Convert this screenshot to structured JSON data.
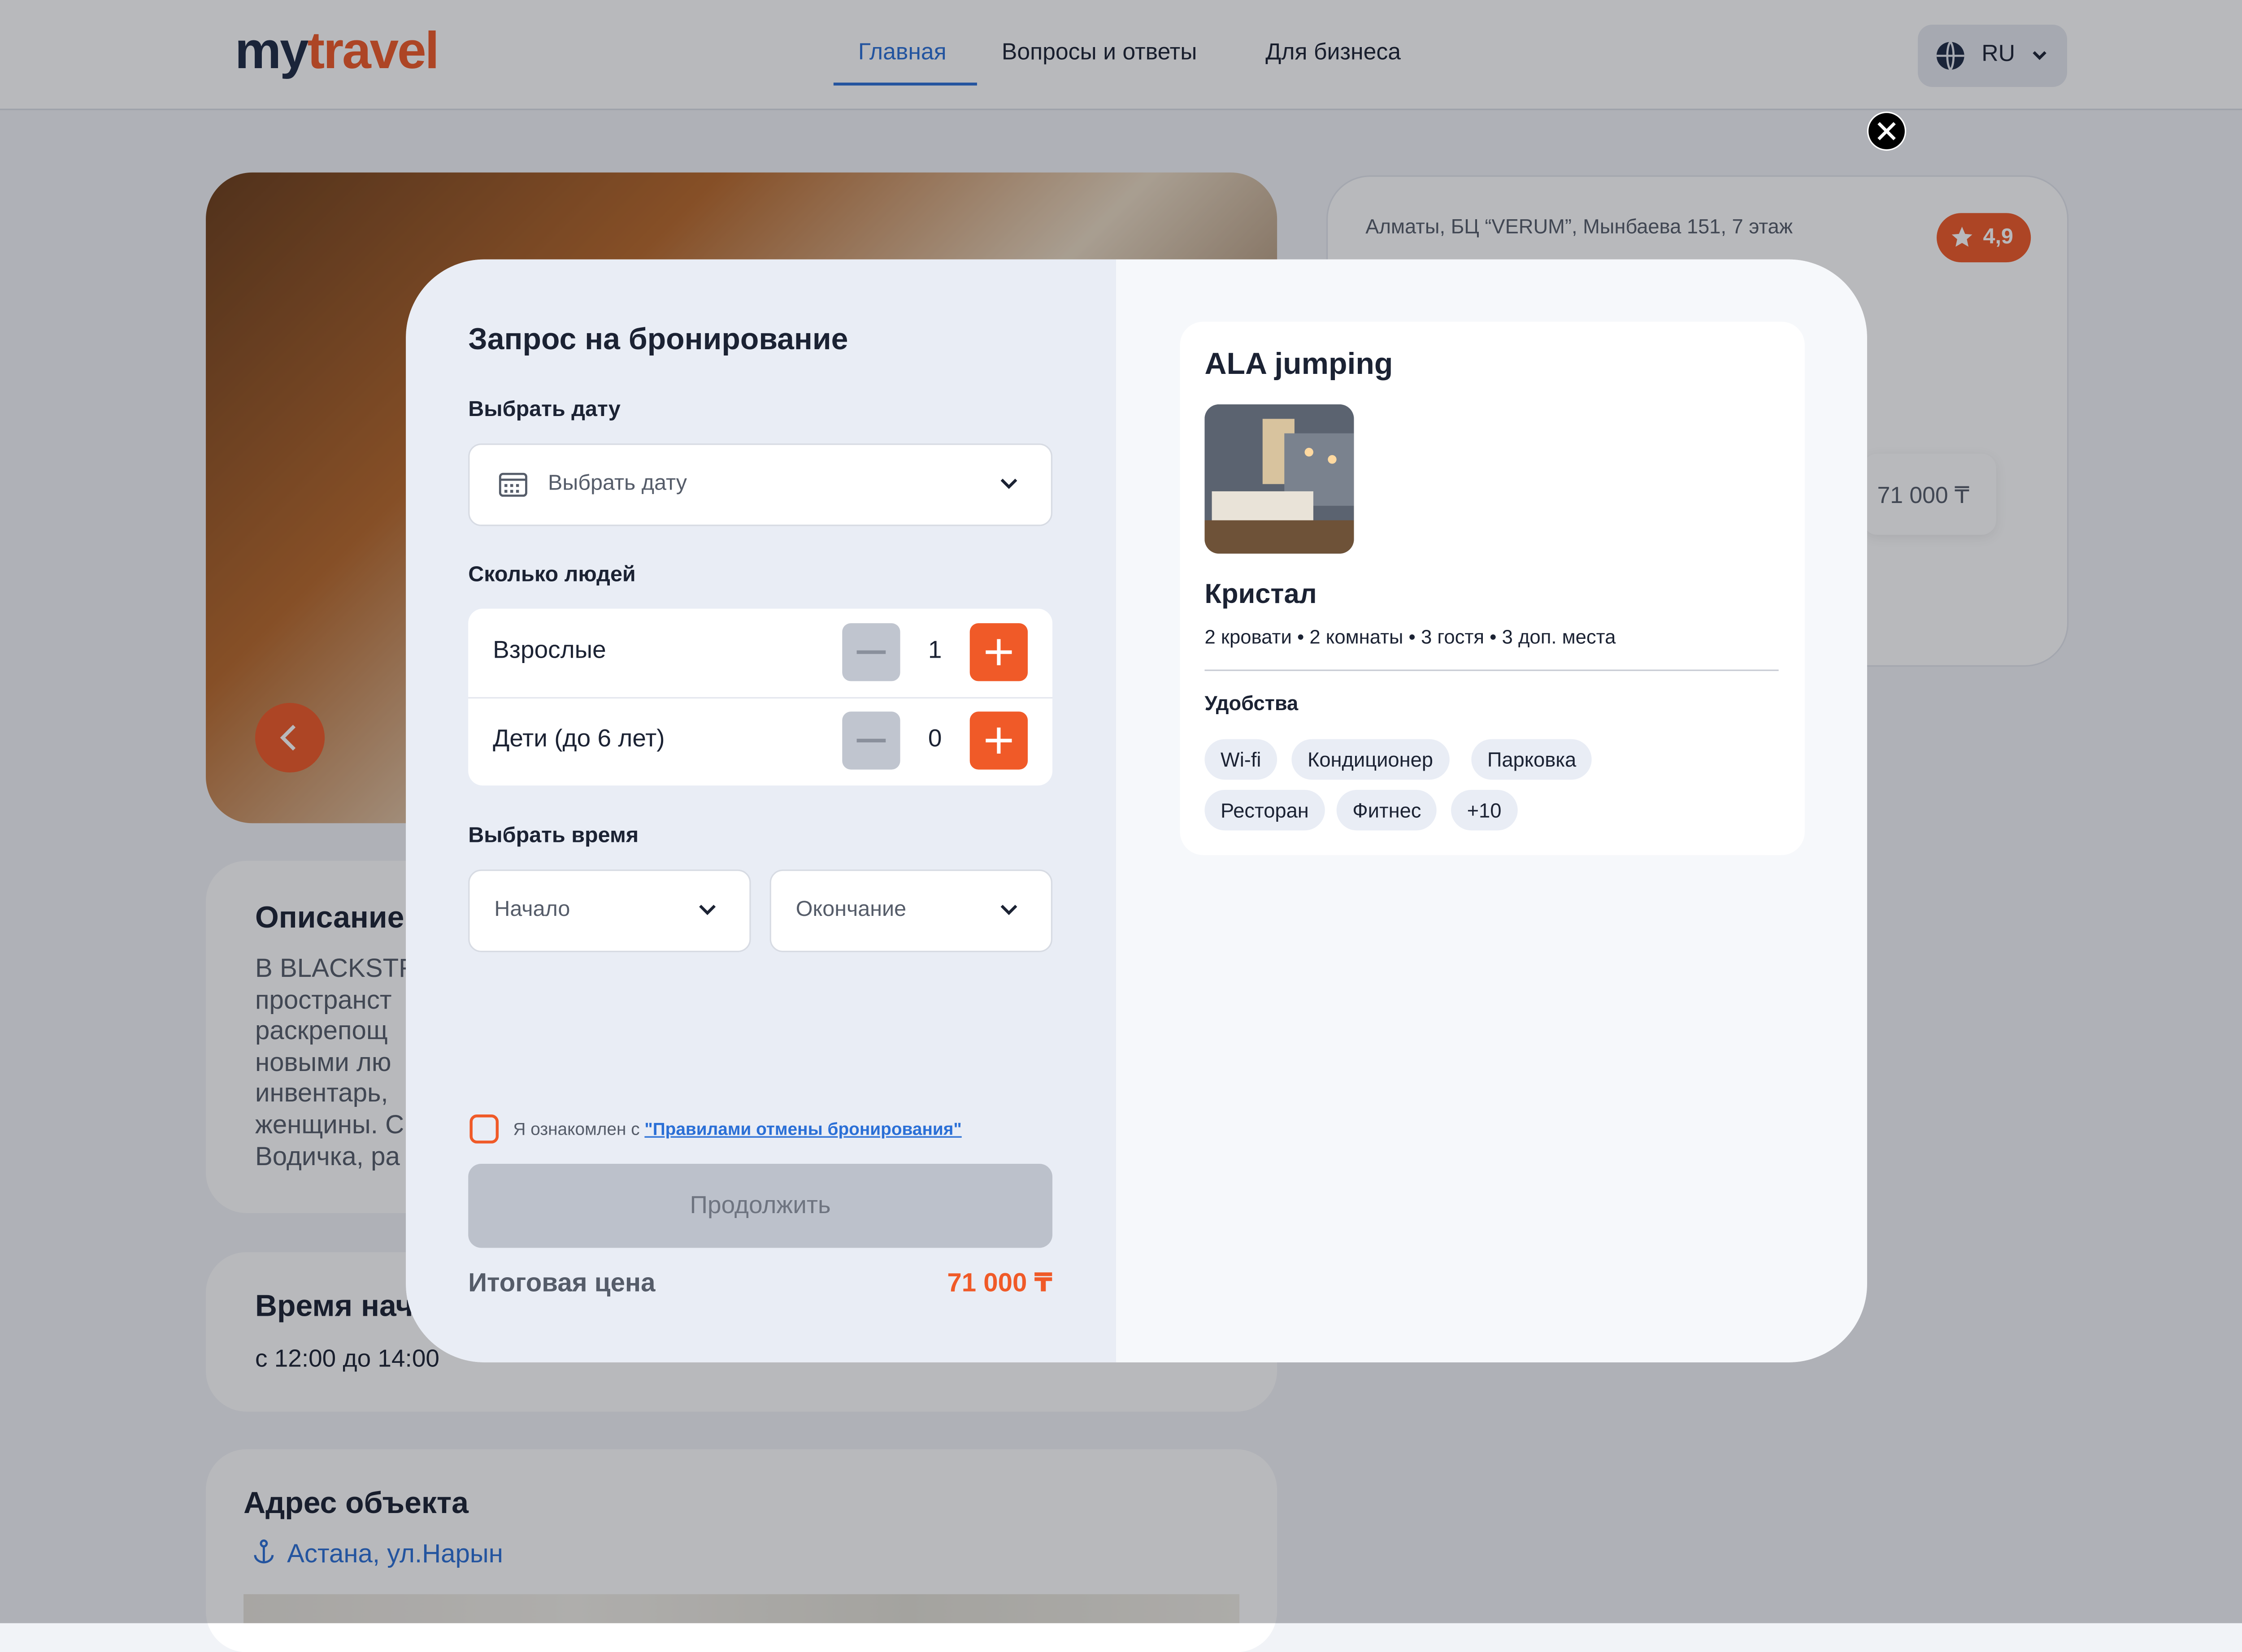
{
  "header": {
    "logo_part1": "my",
    "logo_part2": "travel",
    "nav": [
      "Главная",
      "Вопросы и ответы",
      "Для бизнеса"
    ],
    "active_nav": "Главная",
    "language": "RU"
  },
  "background": {
    "address": "Алматы, БЦ “VERUM”, Мынбаева 151, 7 этаж",
    "rating": "4,9",
    "price": "71 000 ₸",
    "description_title": "Описание",
    "description_text": [
      "В BLACKSTR",
      "пространст",
      "раскрепощ",
      "новыми лю",
      "инвентарь,",
      "женщины. С",
      "Водичка, ра"
    ],
    "time_title": "Время нач",
    "time_value": "с 12:00  до 14:00",
    "address_title": "Адрес объекта",
    "address_value": "Астана, ул.Нарын"
  },
  "modal": {
    "title": "Запрос на бронирование",
    "date_label": "Выбрать дату",
    "date_placeholder": "Выбрать дату",
    "people_label": "Сколько людей",
    "adults_label": "Взрослые",
    "adults_count": "1",
    "children_label": "Дети (до 6 лет)",
    "children_count": "0",
    "time_label": "Выбрать время",
    "start_placeholder": "Начало",
    "end_placeholder": "Окончание",
    "agree_text": "Я ознакомлен с ",
    "agree_link": "\"Правилами отмены бронирования\"",
    "continue_label": "Продолжить",
    "total_label": "Итоговая цена",
    "total_value": "71 000 ₸"
  },
  "hotel": {
    "name": "ALA jumping",
    "room_name": "Кристал",
    "room_desc": "2 кровати • 2 комнаты • 3 гостя • 3 доп. места",
    "amenities_title": "Удобства",
    "amenities": [
      "Wi-fi",
      "Кондиционер",
      "Парковка",
      "Ресторан",
      "Фитнес",
      "+10"
    ]
  },
  "colors": {
    "accent": "#f05a28",
    "link": "#2a6fd6"
  }
}
